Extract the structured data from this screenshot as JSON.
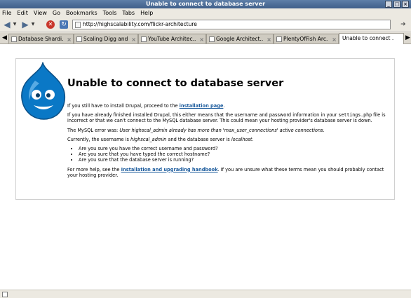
{
  "window": {
    "title": "Unable to connect to database server"
  },
  "menu": [
    {
      "label": "File"
    },
    {
      "label": "Edit"
    },
    {
      "label": "View"
    },
    {
      "label": "Go"
    },
    {
      "label": "Bookmarks"
    },
    {
      "label": "Tools"
    },
    {
      "label": "Tabs"
    },
    {
      "label": "Help"
    }
  ],
  "navigation": {
    "url": "http://highscalability.com/flickr-architecture",
    "icons": [
      "back-icon",
      "forward-icon",
      "stop-icon",
      "reload-icon",
      "go-icon"
    ]
  },
  "tabs": [
    {
      "label": "Database Shardi...",
      "active": false
    },
    {
      "label": "Scaling Digg and...",
      "active": false
    },
    {
      "label": "YouTube Architec...",
      "active": false
    },
    {
      "label": "Google Architect...",
      "active": false
    },
    {
      "label": "PlentyOfFish Arc...",
      "active": false
    },
    {
      "label": "Unable to connect ...",
      "active": true
    }
  ],
  "page": {
    "title": "Unable to connect to database server",
    "p1_pre": "If you still have to install Drupal, proceed to the ",
    "p1_link": "installation page",
    "p1_post": ".",
    "p2_pre": "If you have already finished installed Drupal, this either means that the username and password information in your ",
    "p2_file": "settings.php",
    "p2_post": " file is incorrect or that we can't connect to the MySQL database server. This could mean your hosting provider's database server is down.",
    "p3_pre": "The MySQL error was: ",
    "p3_error": "User highscal_admin already has more than 'max_user_connections' active connections",
    "p3_post": ".",
    "p4_a": "Currently, the username is ",
    "p4_user": "highscal_admin",
    "p4_b": " and the database server is ",
    "p4_server": "localhost",
    "p4_c": ".",
    "bullets": [
      "Are you sure you have the correct username and password?",
      "Are you sure that you have typed the correct hostname?",
      "Are you sure that the database server is running?"
    ],
    "p5_pre": "For more help, see the ",
    "p5_link": "Installation and upgrading handbook",
    "p5_post": ". If you are unsure what these terms mean you should probably contact your hosting provider."
  },
  "colors": {
    "titlebar": "#4a6b95",
    "link": "#1a5a9c",
    "drupal_blue": "#0a78c6"
  }
}
